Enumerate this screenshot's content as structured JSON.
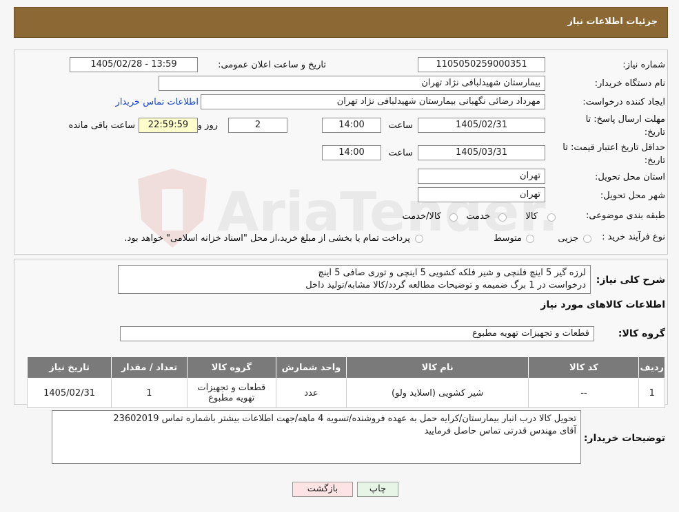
{
  "header": {
    "title": "جزئیات اطلاعات نیاز"
  },
  "fields": {
    "need_no_label": "شماره نیاز:",
    "need_no": "1105050259000351",
    "announce_label": "تاریخ و ساعت اعلان عمومی:",
    "announce_value": "1405/02/28 - 13:59",
    "buyer_org_label": "نام دستگاه خریدار:",
    "buyer_org": "بیمارستان شهیدلبافی نژاد تهران",
    "creator_label": "ایجاد کننده درخواست:",
    "creator": "مهرداد رضائی نگهبانی بیمارستان شهیدلبافی نژاد تهران",
    "contact_link": "اطلاعات تماس خریدار",
    "deadline_label_1": "مهلت ارسال پاسخ: تا",
    "deadline_label_2": "تاریخ:",
    "deadline_date": "1405/02/31",
    "time_label": "ساعت",
    "deadline_time": "14:00",
    "days_value": "2",
    "days_label": "روز و",
    "remaining_time": "22:59:59",
    "remaining_label": "ساعت باقی مانده",
    "validity_label_1": "حداقل تاریخ اعتبار قیمت: تا",
    "validity_label_2": "تاریخ:",
    "validity_date": "1405/03/31",
    "validity_time": "14:00",
    "province_label": "استان محل تحویل:",
    "province": "تهران",
    "city_label": "شهر محل تحویل:",
    "city": "تهران",
    "category_label": "طبقه بندی موضوعی:",
    "category_options": [
      "کالا",
      "خدمت",
      "کالا/خدمت"
    ],
    "purchase_label": "نوع فرآیند خرید :",
    "purchase_options": [
      "جزیی",
      "متوسط"
    ],
    "purchase_note": "پرداخت تمام یا بخشی از مبلغ خرید،از محل \"اسناد خزانه اسلامی\" خواهد بود."
  },
  "description": {
    "label": "شرح کلی نیاز:",
    "line1": "لرزه گیر 5 اینچ فلنچی و شیر فلکه کشویی 5 اینچی و توری صافی 5 اینچ",
    "line2": "درخواست در 1 برگ ضمیمه و توضیحات مطالعه گردد/کالا مشابه/تولید داخل"
  },
  "goods": {
    "section_title": "اطلاعات کالاهای مورد نیاز",
    "group_label": "گروه کالا:",
    "group_value": "قطعات و تجهیزات تهویه مطبوع",
    "columns": [
      "ردیف",
      "کد کالا",
      "نام کالا",
      "واحد شمارش",
      "گروه کالا",
      "تعداد / مقدار",
      "تاریخ نیاز"
    ],
    "rows": [
      [
        "1",
        "--",
        "شیر کشویی (اسلاید ولو)",
        "عدد",
        "قطعات و تجهیزات تهویه مطبوع",
        "1",
        "1405/02/31"
      ]
    ]
  },
  "buyer_notes": {
    "label": "توضیحات خریدار:",
    "line1": "تحویل کالا درب انبار بیمارستان/کرایه حمل به عهده فروشنده/تسویه 4 ماهه/جهت اطلاعات بیشتر باشماره تماس 23602019",
    "line2": "آقای مهندس قدرتی تماس حاصل فرمایید"
  },
  "buttons": {
    "print": "چاپ",
    "back": "بازگشت"
  },
  "watermark": "AriaTender.neT",
  "colors": {
    "header_bg": "#8b6834",
    "table_header": "#7a7a7a",
    "link": "#1a48c7",
    "remaining_bg": "#ffffcc",
    "back_btn": "#fde3e3",
    "print_btn": "#e6f5e6"
  }
}
